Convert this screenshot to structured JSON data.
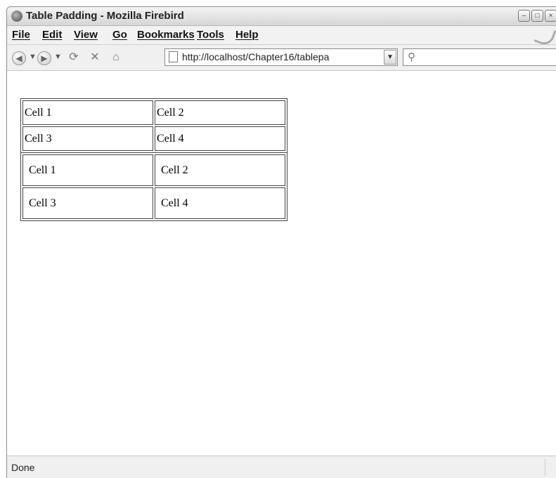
{
  "window": {
    "title": "Table Padding - Mozilla Firebird"
  },
  "window_buttons": {
    "minimize": "–",
    "maximize": "□",
    "close": "×"
  },
  "menu": [
    "File",
    "Edit",
    "View",
    "Go",
    "Bookmarks",
    "Tools",
    "Help"
  ],
  "nav": {
    "url": "http://localhost/Chapter16/tablepa",
    "search_placeholder": ""
  },
  "tables": [
    {
      "rows": [
        [
          "Cell 1",
          "Cell 2"
        ],
        [
          "Cell 3",
          "Cell 4"
        ]
      ]
    },
    {
      "rows": [
        [
          "Cell 1",
          "Cell 2"
        ],
        [
          "Cell 3",
          "Cell 4"
        ]
      ]
    }
  ],
  "status": {
    "text": "Done"
  },
  "icons": {
    "back": "back-arrow-icon",
    "forward": "forward-arrow-icon",
    "reload": "reload-icon",
    "stop": "stop-icon",
    "home": "home-icon",
    "page": "page-icon",
    "search": "search-icon"
  }
}
